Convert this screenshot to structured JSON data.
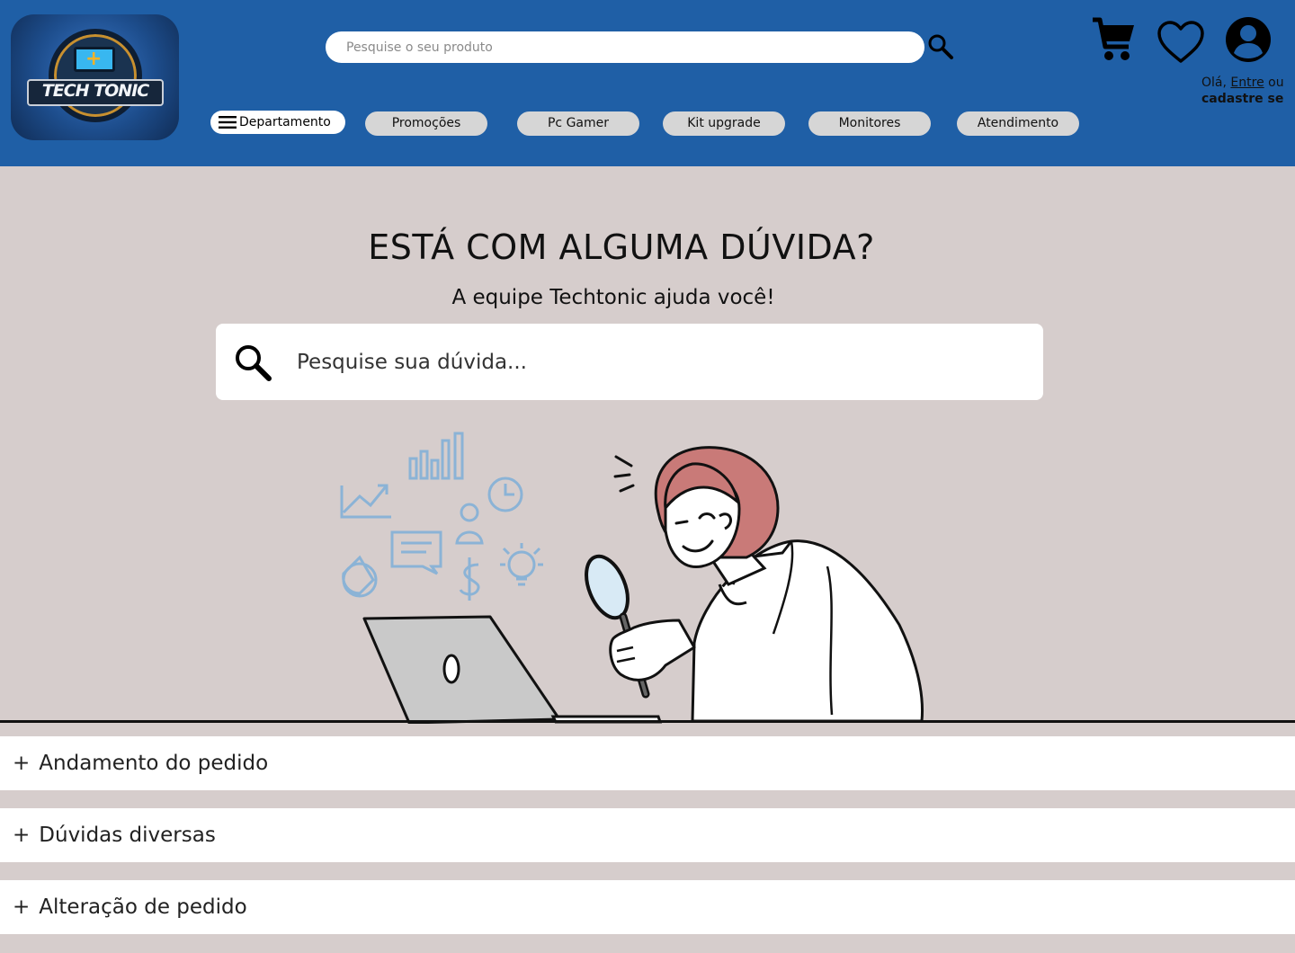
{
  "header": {
    "logo_text": "TECH TONIC",
    "search_placeholder": "Pesquise o seu produto",
    "icons": [
      "search-icon",
      "cart-icon",
      "heart-icon",
      "user-icon"
    ],
    "greeting": {
      "prefix": "Olá,",
      "login": "Entre",
      "or": "ou",
      "signup": "cadastre se"
    },
    "department_label": "Departamento",
    "nav": [
      "Promoções",
      "Pc Gamer",
      "Kit upgrade",
      "Monitores",
      "Atendimento"
    ]
  },
  "main": {
    "title": "ESTÁ COM ALGUMA DÚVIDA?",
    "subtitle": "A equipe Techtonic ajuda você!",
    "search_placeholder": "Pesquise sua dúvida..."
  },
  "faq": [
    {
      "icon": "+",
      "label": "Andamento do pedido"
    },
    {
      "icon": "+",
      "label": "Dúvidas diversas"
    },
    {
      "icon": "+",
      "label": "Alteração de pedido"
    }
  ],
  "colors": {
    "header_bg": "#1f5fa6",
    "page_bg": "#d6cdcc",
    "pill_bg": "#d6d6d6",
    "hair": "#c97a78"
  }
}
